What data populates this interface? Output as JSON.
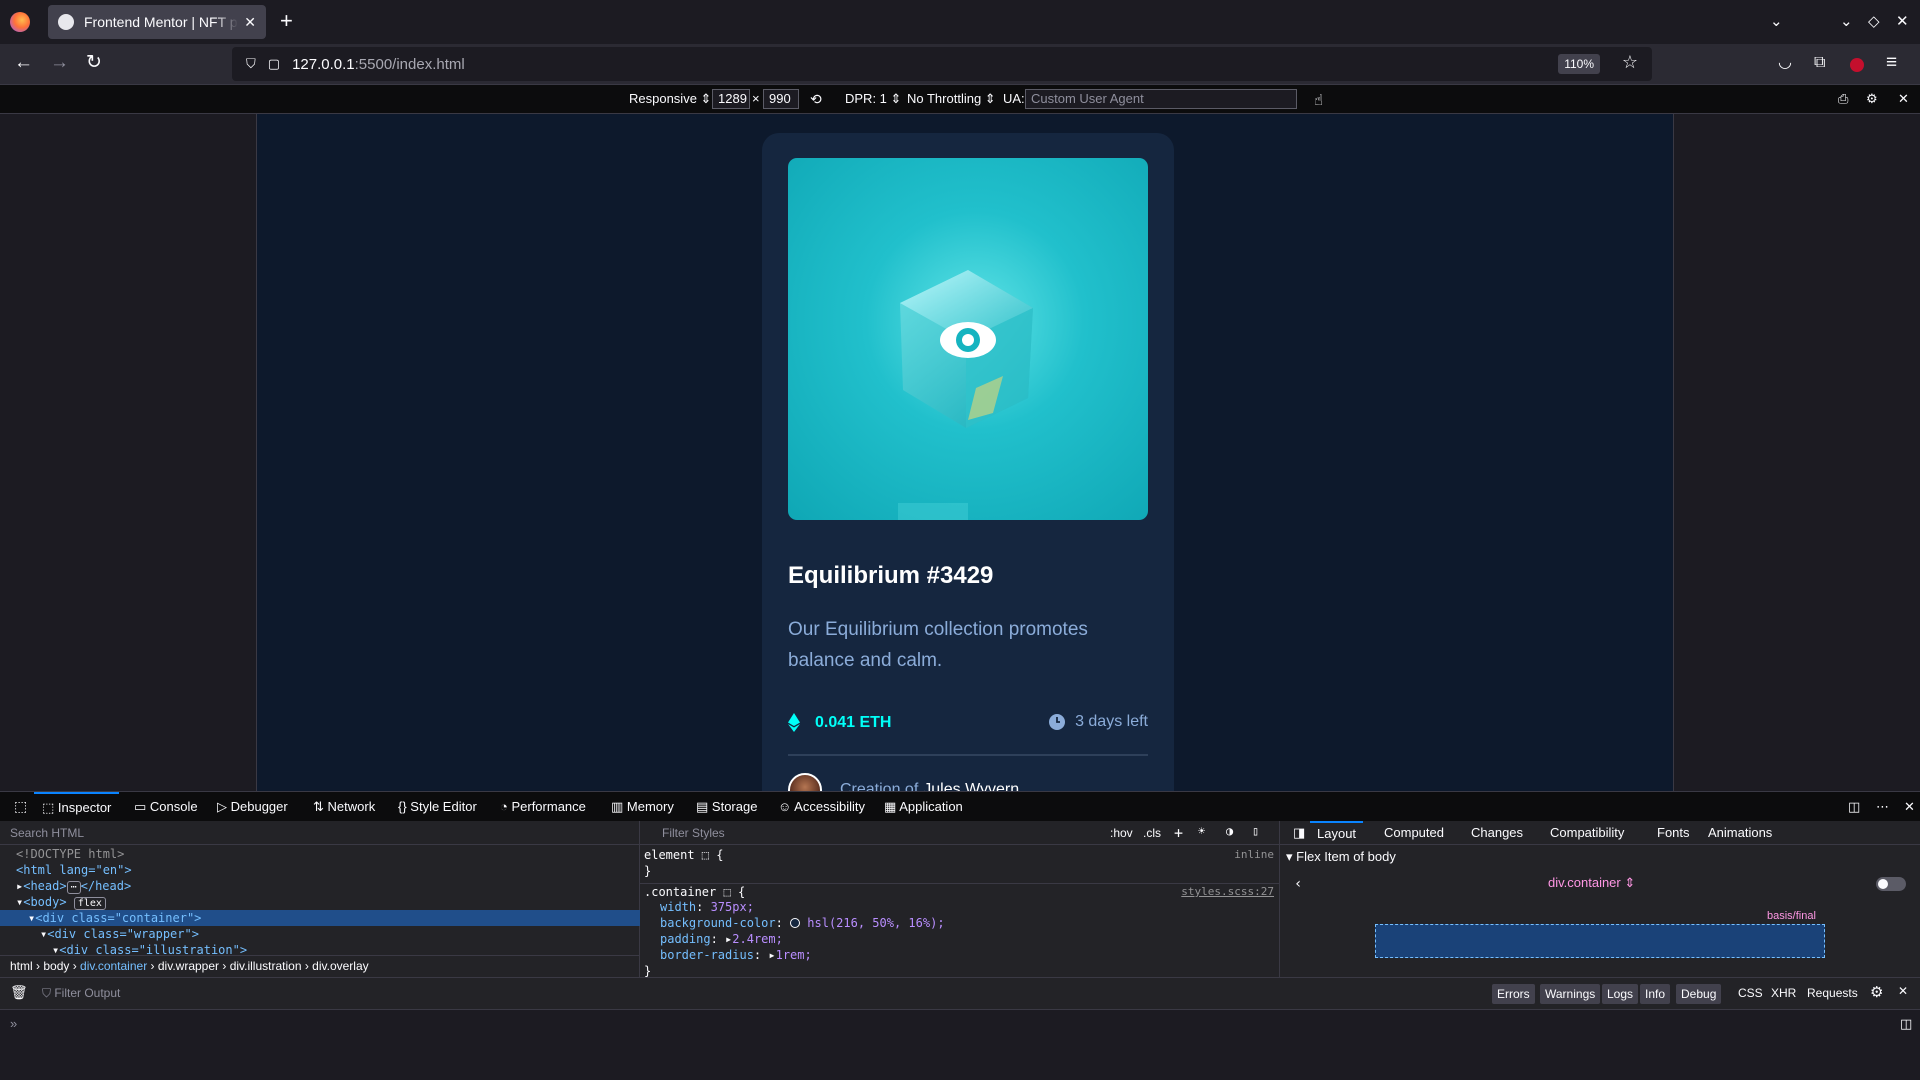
{
  "browser": {
    "tab_title": "Frontend Mentor | NFT pr",
    "url_host": "127.0.0.1",
    "url_path": ":5500/index.html",
    "zoom": "110%"
  },
  "rdm": {
    "device": "Responsive",
    "width": "1289",
    "times": "×",
    "height": "990",
    "dpr": "DPR: 1",
    "throttling": "No Throttling",
    "ua_label": "UA:",
    "ua_placeholder": "Custom User Agent"
  },
  "card": {
    "title": "Equilibrium #3429",
    "description": "Our Equilibrium collection promotes balance and calm.",
    "price": "0.041 ETH",
    "time_left": "3 days left",
    "creation_prefix": "Creation of",
    "creator_name": "Jules Wyvern"
  },
  "devtools": {
    "tabs": [
      "Inspector",
      "Console",
      "Debugger",
      "Network",
      "Style Editor",
      "Performance",
      "Memory",
      "Storage",
      "Accessibility",
      "Application"
    ],
    "search_html_placeholder": "Search HTML",
    "markup": {
      "doctype": "<!DOCTYPE html>",
      "html_open": "<html lang=\"en\">",
      "head": "<head>",
      "head_ellipsis": "⋯",
      "head_close": "</head>",
      "body": "<body>",
      "flex_badge": "flex",
      "container": "<div class=\"container\">",
      "wrapper": "<div class=\"wrapper\">",
      "illustration": "<div class=\"illustration\">"
    },
    "breadcrumbs": [
      "html",
      "body",
      "div.container",
      "div.wrapper",
      "div.illustration",
      "div.overlay"
    ],
    "filter_styles_placeholder": "Filter Styles",
    "rules_toolbar": [
      ":hov",
      ".cls"
    ],
    "rules": {
      "element_selector": "element",
      "element_brace": "{",
      "inline": "inline",
      "close": "}",
      "container_selector": ".container",
      "source": "styles.scss:27",
      "props": [
        {
          "name": "width",
          "value": "375px;"
        },
        {
          "name": "background-color",
          "value": "hsl(216, 50%, 16%);"
        },
        {
          "name": "padding",
          "value": "2.4rem;"
        },
        {
          "name": "border-radius",
          "value": "1rem;"
        }
      ]
    },
    "layout_tabs": [
      "Layout",
      "Computed",
      "Changes",
      "Compatibility",
      "Fonts",
      "Animations"
    ],
    "flex_item_header": "Flex Item of body",
    "flex_item_selector": "div.container",
    "basis_label": "basis/final",
    "console": {
      "filter_placeholder": "Filter Output",
      "levels": [
        "Errors",
        "Warnings",
        "Logs",
        "Info",
        "Debug"
      ],
      "extra": [
        "CSS",
        "XHR",
        "Requests"
      ]
    }
  },
  "colors": {
    "page_bg": "#0d192c",
    "card_bg": "#15263f",
    "accent_cyan": "#00fff8",
    "soft_blue": "#8bacd9"
  }
}
